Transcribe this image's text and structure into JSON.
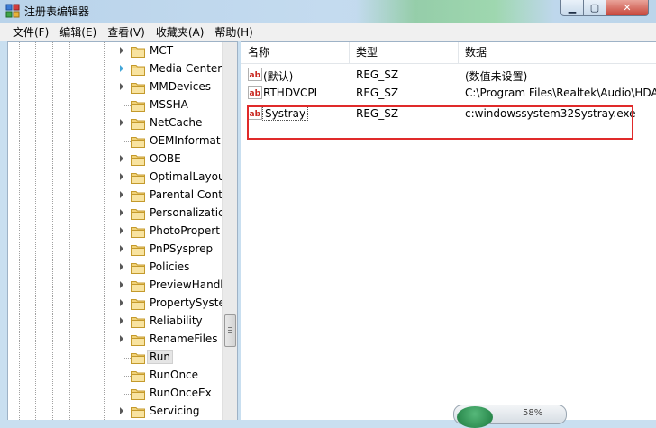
{
  "window": {
    "title": "注册表编辑器",
    "min_glyph": "▁",
    "max_glyph": "▢",
    "close_glyph": "✕"
  },
  "menu": [
    "文件(F)",
    "编辑(E)",
    "查看(V)",
    "收藏夹(A)",
    "帮助(H)"
  ],
  "tree": {
    "items": [
      {
        "label": "MCT",
        "expander": "collapsed"
      },
      {
        "label": "Media Center",
        "expander": "collapsed-blue"
      },
      {
        "label": "MMDevices",
        "expander": "collapsed"
      },
      {
        "label": "MSSHA",
        "expander": "none"
      },
      {
        "label": "NetCache",
        "expander": "collapsed"
      },
      {
        "label": "OEMInformat",
        "expander": "none"
      },
      {
        "label": "OOBE",
        "expander": "collapsed"
      },
      {
        "label": "OptimalLayou",
        "expander": "collapsed"
      },
      {
        "label": "Parental Cont",
        "expander": "collapsed"
      },
      {
        "label": "Personalizatic",
        "expander": "collapsed"
      },
      {
        "label": "PhotoPropert",
        "expander": "collapsed"
      },
      {
        "label": "PnPSysprep",
        "expander": "collapsed"
      },
      {
        "label": "Policies",
        "expander": "collapsed"
      },
      {
        "label": "PreviewHandl",
        "expander": "collapsed"
      },
      {
        "label": "PropertySyste",
        "expander": "collapsed"
      },
      {
        "label": "Reliability",
        "expander": "collapsed"
      },
      {
        "label": "RenameFiles",
        "expander": "collapsed"
      },
      {
        "label": "Run",
        "expander": "none",
        "selected": true
      },
      {
        "label": "RunOnce",
        "expander": "none"
      },
      {
        "label": "RunOnceEx",
        "expander": "none"
      },
      {
        "label": "Servicing",
        "expander": "collapsed"
      }
    ]
  },
  "list": {
    "columns": [
      "名称",
      "类型",
      "数据"
    ],
    "rows": [
      {
        "name": "(默认)",
        "type": "REG_SZ",
        "data": "(数值未设置)"
      },
      {
        "name": "RTHDVCPL",
        "type": "REG_SZ",
        "data": "C:\\Program Files\\Realtek\\Audio\\HDA"
      },
      {
        "name": "Systray",
        "type": "REG_SZ",
        "data": "c:windowssystem32Systray.exe",
        "editing": true
      }
    ]
  },
  "floating_widget": {
    "text": "58%"
  },
  "colors": {
    "highlight_border": "#e02a2a",
    "titlebar": "#c4dbef"
  }
}
